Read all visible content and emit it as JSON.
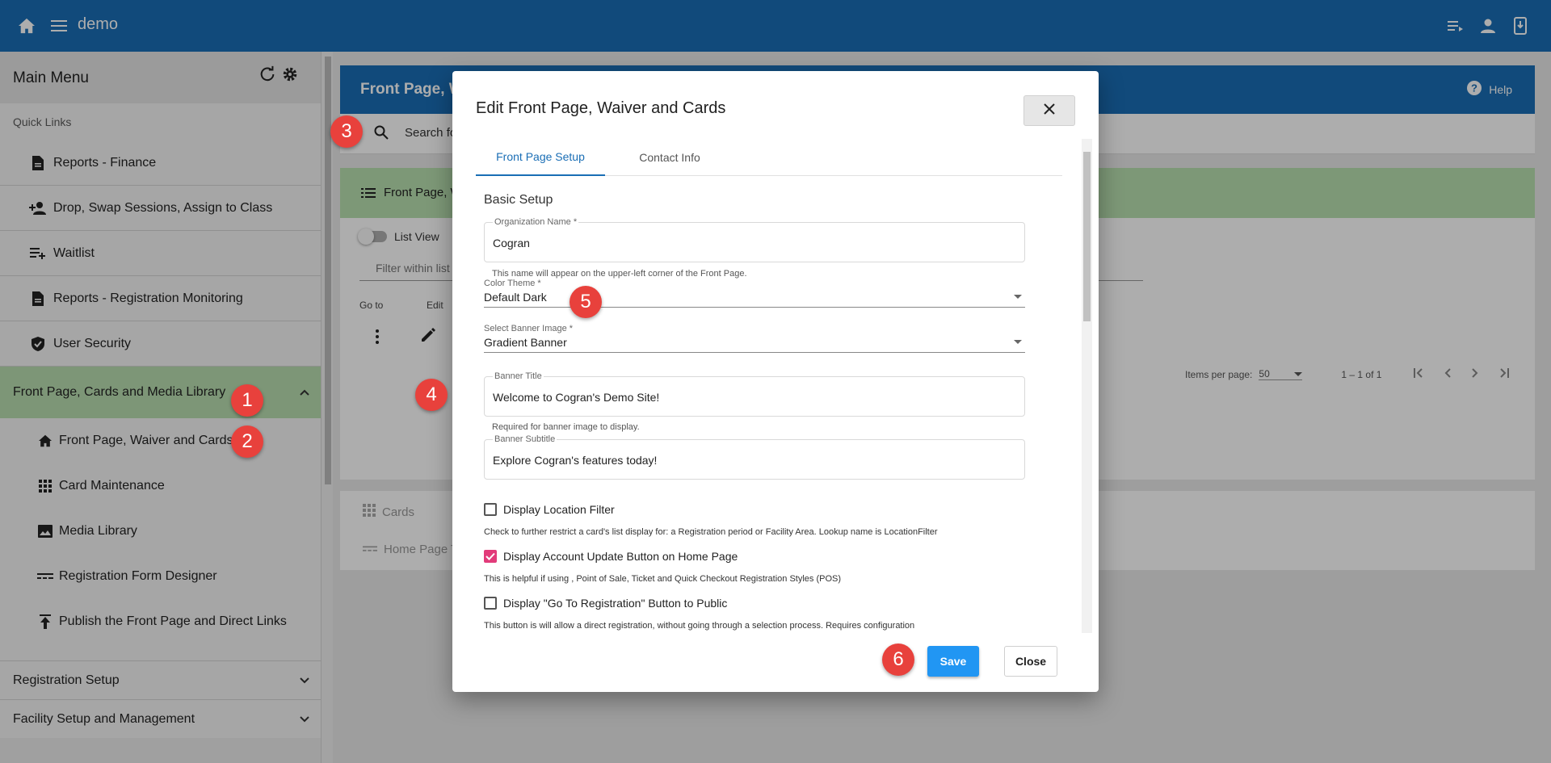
{
  "app": {
    "title": "demo"
  },
  "sidebar": {
    "title": "Main Menu",
    "quick_links_label": "Quick Links",
    "items": [
      {
        "label": "Reports - Finance",
        "icon": "document-icon"
      },
      {
        "label": "Drop, Swap Sessions, Assign to Class",
        "icon": "person-add-icon"
      },
      {
        "label": "Waitlist",
        "icon": "playlist-add-icon"
      },
      {
        "label": "Reports - Registration Monitoring",
        "icon": "document-icon"
      },
      {
        "label": "User Security",
        "icon": "shield-check-icon"
      }
    ],
    "group": {
      "label": "Front Page, Cards and Media Library"
    },
    "sub_items": [
      {
        "label": "Front Page, Waiver and Cards",
        "icon": "home-icon"
      },
      {
        "label": "Card Maintenance",
        "icon": "grid-icon"
      },
      {
        "label": "Media Library",
        "icon": "image-icon"
      },
      {
        "label": "Registration Form Designer",
        "icon": "form-lines-icon"
      },
      {
        "label": "Publish the Front Page and Direct Links",
        "icon": "publish-icon"
      }
    ],
    "sections": [
      {
        "label": "Registration Setup"
      },
      {
        "label": "Facility Setup and Management"
      }
    ]
  },
  "main": {
    "panel_title": "Front Page, W",
    "help_label": "Help",
    "search_placeholder": "Search for fr",
    "fp_card_title": "Front Page, W",
    "list_view_label": "List View",
    "filter_placeholder": "Filter within list",
    "col_goto": "Go to",
    "col_edit": "Edit",
    "items_per_page_label": "Items per page:",
    "items_per_page_value": "50",
    "range_label": "1 – 1 of 1",
    "cards_label": "Cards",
    "home_page_label": "Home Page T"
  },
  "dialog": {
    "title": "Edit Front Page, Waiver and Cards",
    "tabs": [
      "Front Page Setup",
      "Contact Info"
    ],
    "section_title": "Basic Setup",
    "org_name": {
      "label": "Organization Name *",
      "value": "Cogran",
      "hint": "This name will appear on the upper-left corner of the Front Page."
    },
    "color_theme": {
      "label": "Color Theme *",
      "value": "Default Dark"
    },
    "banner_image": {
      "label": "Select Banner Image *",
      "value": "Gradient Banner"
    },
    "banner_title": {
      "label": "Banner Title",
      "value": "Welcome to Cogran's Demo Site!",
      "hint": "Required for banner image to display."
    },
    "banner_subtitle": {
      "label": "Banner Subtitle",
      "value": "Explore Cogran's features today!"
    },
    "checkboxes": [
      {
        "label": "Display Location Filter",
        "checked": false,
        "help": "Check to further restrict a card's list display for: a Registration period or Facility Area. Lookup name is LocationFilter"
      },
      {
        "label": "Display Account Update Button on Home Page",
        "checked": true,
        "help": "This is helpful if using , Point of Sale, Ticket and Quick Checkout Registration Styles (POS)"
      },
      {
        "label": "Display \"Go To Registration\" Button to Public",
        "checked": false,
        "help": "This button is will allow a direct registration, without going through a selection process. Requires configuration"
      }
    ],
    "save_label": "Save",
    "close_label": "Close"
  },
  "badges": [
    "1",
    "2",
    "3",
    "4",
    "5",
    "6"
  ],
  "colors": {
    "topbar": "#1a6eb5",
    "accent": "#2196f3",
    "group_bg": "#b9e1b0",
    "badge": "#e8413c",
    "checkbox_checked": "#e23b7a"
  }
}
